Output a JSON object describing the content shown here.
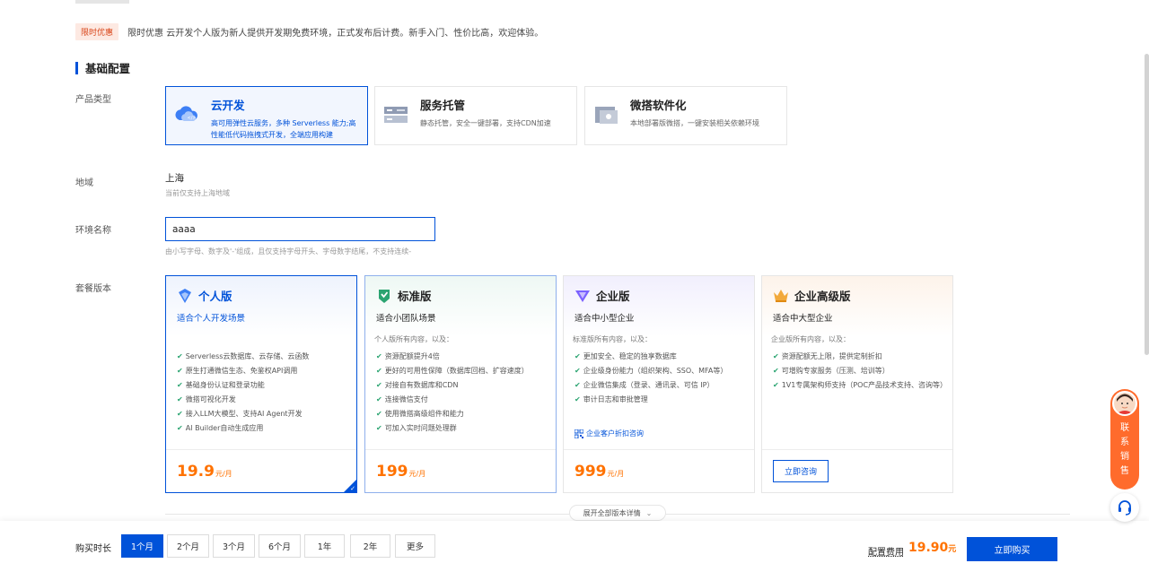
{
  "promo": {
    "tag": "限时优惠",
    "text": "限时优惠 云开发个人版为新人提供开发期免费环境，正式发布后计费。新手入门、性价比高，欢迎体验。"
  },
  "section_title": "基础配置",
  "product_type": {
    "label": "产品类型",
    "options": [
      {
        "title": "云开发",
        "desc": "高可用弹性云服务，多种 Serverless 能力;高性能低代码拖拽式开发，全端应用构建",
        "icon": "cloud-icon",
        "selected": true
      },
      {
        "title": "服务托管",
        "desc": "静态托管，安全一键部署，支持CDN加速",
        "icon": "server-icon",
        "selected": false
      },
      {
        "title": "微搭软件化",
        "desc": "本地部署版微搭，一键安装相关依赖环境",
        "icon": "package-icon",
        "selected": false
      }
    ]
  },
  "region": {
    "label": "地域",
    "value": "上海",
    "hint": "当前仅支持上海地域"
  },
  "env_name": {
    "label": "环境名称",
    "value": "aaaa",
    "hint": "由小写字母、数字及'-'组成，且仅支持字母开头、字母数字结尾，不支持连续-"
  },
  "plans": {
    "label": "套餐版本",
    "items": [
      {
        "name": "个人版",
        "scene": "适合个人开发场景",
        "intro": "",
        "features": [
          "Serverless云数据库、云存储、云函数",
          "原生打通微信生态、免鉴权API调用",
          "基础身份认证和登录功能",
          "微搭可视化开发",
          "接入LLM大模型、支持AI Agent开发",
          "AI Builder自动生成应用"
        ],
        "price": "19.9",
        "unit": "元/月",
        "selected": true
      },
      {
        "name": "标准版",
        "scene": "适合小团队场景",
        "intro": "个人版所有内容，以及：",
        "features": [
          "资源配额提升4倍",
          "更好的可用性保障（数据库回档、扩容速度）",
          "对接自有数据库和CDN",
          "连接微信支付",
          "使用微搭高级组件和能力",
          "可加入实时问题处理群"
        ],
        "price": "199",
        "unit": "元/月",
        "selected": false
      },
      {
        "name": "企业版",
        "scene": "适合中小型企业",
        "intro": "标准版所有内容，以及：",
        "features": [
          "更加安全、稳定的独享数据库",
          "企业级身份能力（组织架构、SSO、MFA等）",
          "企业微信集成（登录、通讯录、可信 IP）",
          "审计日志和审批管理"
        ],
        "link": "企业客户折扣咨询",
        "price": "999",
        "unit": "元/月",
        "selected": false
      },
      {
        "name": "企业高级版",
        "scene": "适合中大型企业",
        "intro": "企业版所有内容，以及：",
        "features": [
          "资源配额无上限，提供定制折扣",
          "可增购专家服务（压测、培训等）",
          "1V1专属架构师支持（POC产品技术支持、咨询等）"
        ],
        "button": "立即咨询",
        "selected": false
      }
    ],
    "expand_label": "展开全部版本详情"
  },
  "duration": {
    "label": "购买时长",
    "options": [
      "1个月",
      "2个月",
      "3个月",
      "6个月",
      "1年",
      "2年",
      "更多"
    ],
    "selected": "1个月"
  },
  "fee": {
    "label": "配置费用",
    "value": "19.90",
    "unit": "元"
  },
  "buy_button": "立即购买",
  "contact": {
    "text": "联系销售"
  },
  "colors": {
    "primary": "#0052d9",
    "price": "#ff7200",
    "promo_tag_bg": "#fde9e2",
    "contact_bg": "#ff6b2c",
    "check": "#2ba471"
  }
}
